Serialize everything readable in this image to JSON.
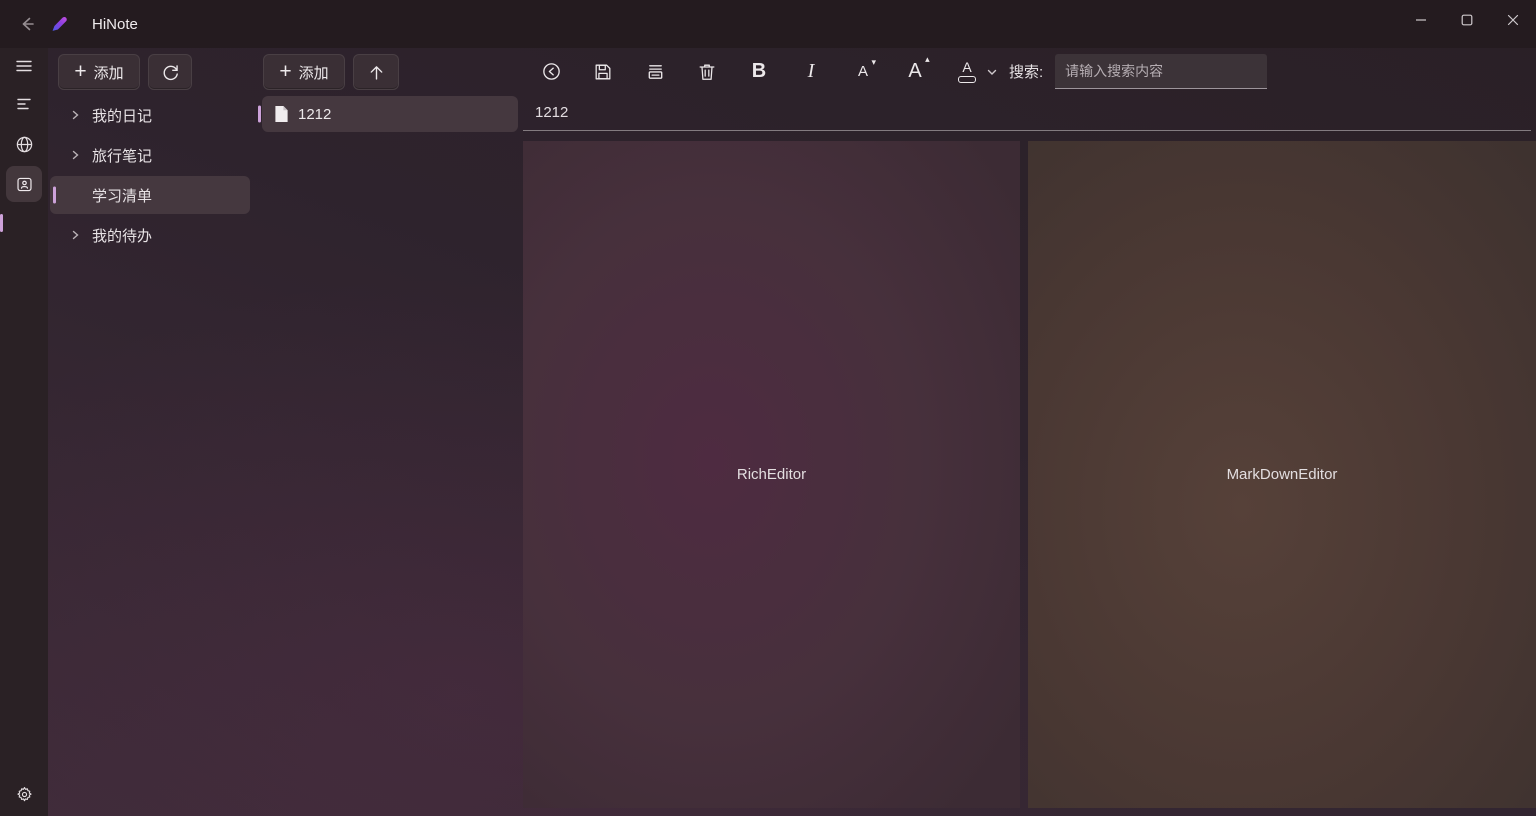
{
  "titlebar": {
    "app_title": "HiNote",
    "icons": {
      "back": "arrow-left-icon",
      "logo": "pen-logo-icon",
      "minimize": "minimize-icon",
      "maximize": "maximize-icon",
      "close": "close-icon"
    }
  },
  "colors": {
    "accent_bar": "#cda2da",
    "selection_bg": "#45383f",
    "button_bg": "#3a2f35",
    "logo_gradient_start": "#4a5ae8",
    "logo_gradient_end": "#c44fe0"
  },
  "rail": {
    "icons": [
      "menu-icon",
      "list-lines-icon",
      "globe-icon",
      "contact-card-icon",
      "settings-gear-icon"
    ],
    "selected_index": 3
  },
  "categories_panel": {
    "add_button": "添加",
    "refresh_icon": "refresh-icon",
    "items": [
      {
        "label": "我的日记",
        "expandable": true,
        "selected": false
      },
      {
        "label": "旅行笔记",
        "expandable": true,
        "selected": false
      },
      {
        "label": "学习清单",
        "expandable": false,
        "selected": true
      },
      {
        "label": "我的待办",
        "expandable": true,
        "selected": false
      }
    ]
  },
  "notes_panel": {
    "add_button": "添加",
    "move_up_icon": "arrow-up-icon",
    "items": [
      {
        "title": "1212",
        "icon": "file-icon",
        "selected": true
      }
    ]
  },
  "editor": {
    "toolbar": {
      "icons": [
        "history-icon",
        "save-icon",
        "print-icon",
        "trash-icon"
      ],
      "bold_label": "B",
      "italic_label": "I",
      "font_decrease_label": "A",
      "font_decrease_caret": "▾",
      "font_increase_label": "A",
      "font_increase_caret": "▴",
      "font_color_label": "A",
      "search_label": "搜索:",
      "search_placeholder": "请输入搜索内容",
      "search_value": ""
    },
    "title_value": "1212",
    "rich_editor_label": "RichEditor",
    "markdown_editor_label": "MarkDownEditor"
  }
}
